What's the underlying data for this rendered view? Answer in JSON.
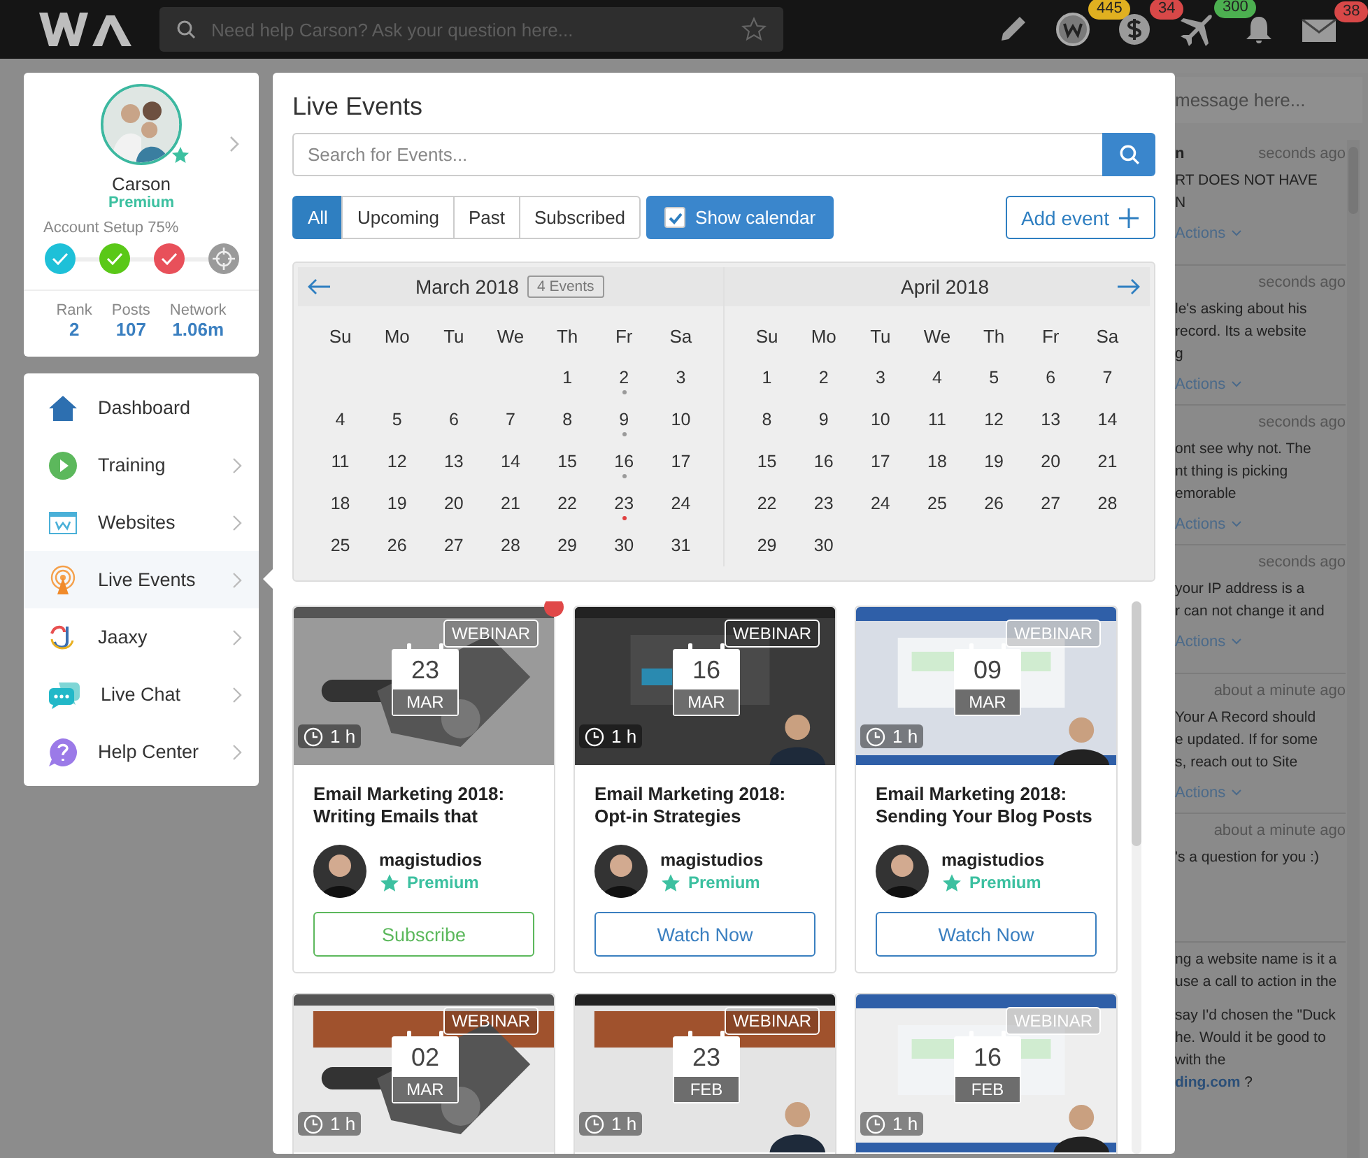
{
  "top_bar": {
    "search": {
      "placeholder": "Need help Carson? Ask your question here..."
    },
    "icons": [
      {
        "kind": "pencil"
      },
      {
        "kind": "coin",
        "count": "445",
        "color": "#e0b020"
      },
      {
        "kind": "dollar",
        "count": "34",
        "color": "#d84848"
      },
      {
        "kind": "plane",
        "count": "300",
        "color": "#4caf50"
      },
      {
        "kind": "bell"
      },
      {
        "kind": "mail",
        "count": "38",
        "color": "#d84848"
      }
    ]
  },
  "profile": {
    "name": "Carson",
    "tier": "Premium",
    "setup": "Account Setup 75%",
    "steps": [
      {
        "color": "#1ec0d8",
        "done": true
      },
      {
        "color": "#5ac818",
        "done": true
      },
      {
        "color": "#e8505a",
        "done": true
      },
      {
        "color": "#9a9a9a",
        "done": false
      }
    ],
    "stats": [
      {
        "label": "Rank",
        "value": "2"
      },
      {
        "label": "Posts",
        "value": "107"
      },
      {
        "label": "Network",
        "value": "1.06m"
      }
    ]
  },
  "sidebar": {
    "nav": [
      {
        "label": "Dashboard",
        "chevron": false,
        "selected": false
      },
      {
        "label": "Training",
        "chevron": true,
        "selected": false
      },
      {
        "label": "Websites",
        "chevron": true,
        "selected": false
      },
      {
        "label": "Live Events",
        "chevron": true,
        "selected": true
      },
      {
        "label": "Jaaxy",
        "chevron": true,
        "selected": false
      },
      {
        "label": "Live Chat",
        "chevron": true,
        "selected": false
      },
      {
        "label": "Help Center",
        "chevron": true,
        "selected": false
      }
    ]
  },
  "modal": {
    "title": "Live Events",
    "search": {
      "placeholder": "Search for Events..."
    },
    "tabs": [
      {
        "label": "All",
        "selected": true
      },
      {
        "label": "Upcoming",
        "selected": false
      },
      {
        "label": "Past",
        "selected": false
      },
      {
        "label": "Subscribed",
        "selected": false
      }
    ],
    "show_calendar": {
      "label": "Show calendar",
      "checked": true
    },
    "add_event": "Add event",
    "calendar": {
      "months": [
        {
          "title": "March 2018",
          "events_badge": "4 Events",
          "weekdays": [
            "Su",
            "Mo",
            "Tu",
            "We",
            "Th",
            "Fr",
            "Sa"
          ],
          "weeks": [
            [
              "1",
              {
                "label": "2",
                "color": "#9a9a9a"
              },
              "3"
            ],
            [
              "4",
              "5",
              "6",
              "7",
              "8",
              {
                "label": "9",
                "color": "#9a9a9a"
              },
              "10"
            ],
            [
              "11",
              "12",
              "13",
              "14",
              "15",
              {
                "label": "16",
                "color": "#9a9a9a"
              },
              "17"
            ],
            [
              "18",
              "19",
              "20",
              "21",
              "22",
              {
                "label": "23",
                "color": "#e04040"
              },
              "24"
            ],
            [
              "25",
              "26",
              "27",
              "28",
              "29",
              "30",
              "31"
            ]
          ]
        },
        {
          "title": "April 2018",
          "weekdays": [
            "Su",
            "Mo",
            "Tu",
            "We",
            "Th",
            "Fr",
            "Sa"
          ],
          "weeks": [
            [
              "1",
              "2",
              "3",
              "4",
              "5",
              "6",
              "7"
            ],
            [
              "8",
              "9",
              "10",
              "11",
              "12",
              "13",
              "14"
            ],
            [
              "15",
              "16",
              "17",
              "18",
              "19",
              "20",
              "21"
            ],
            [
              "22",
              "23",
              "24",
              "25",
              "26",
              "27",
              "28"
            ],
            [
              "29",
              "30"
            ]
          ]
        }
      ]
    },
    "events": [
      {
        "badge": "WEBINAR",
        "day": "23",
        "month": "MAR",
        "duration": "1 h",
        "unread": true,
        "title": "Email Marketing 2018: Writing Emails that",
        "author": "magistudios",
        "tier": "Premium",
        "button": {
          "kind": "subscribe",
          "label": "Subscribe"
        }
      },
      {
        "badge": "WEBINAR",
        "day": "16",
        "month": "MAR",
        "duration": "1 h",
        "unread": false,
        "title": "Email Marketing 2018: Opt-in Strategies",
        "author": "magistudios",
        "tier": "Premium",
        "button": {
          "kind": "watch",
          "label": "Watch Now"
        }
      },
      {
        "badge": "WEBINAR",
        "day": "09",
        "month": "MAR",
        "duration": "1 h",
        "unread": false,
        "title": "Email Marketing 2018: Sending Your Blog Posts",
        "author": "magistudios",
        "tier": "Premium",
        "button": {
          "kind": "watch",
          "label": "Watch Now"
        }
      },
      {
        "badge": "WEBINAR",
        "day": "02",
        "month": "MAR",
        "duration": "1 h",
        "unread": false
      },
      {
        "badge": "WEBINAR",
        "day": "23",
        "month": "FEB",
        "duration": "1 h",
        "unread": false
      },
      {
        "badge": "WEBINAR",
        "day": "16",
        "month": "FEB",
        "duration": "1 h",
        "unread": false
      }
    ]
  },
  "chat": {
    "input": {
      "placeholder": "message here..."
    },
    "messages": [
      {
        "name": "n",
        "time": "seconds ago",
        "lines": [
          "RT DOES NOT HAVE",
          "N"
        ],
        "actions": "Actions"
      },
      {
        "time": "seconds ago",
        "lines": [
          "le's asking about his",
          "record. Its a website",
          "g"
        ],
        "actions": "Actions"
      },
      {
        "time": "seconds ago",
        "lines": [
          "ont see why not. The",
          "nt thing is picking",
          "emorable"
        ],
        "actions": "Actions"
      },
      {
        "time": "seconds ago",
        "lines": [
          "your IP address is a",
          "r can not change it and"
        ],
        "actions": "Actions"
      },
      {
        "time": "about a minute ago",
        "lines": [
          "Your A Record should",
          "e updated. If for some",
          "s, reach out to Site"
        ],
        "actions": "Actions"
      },
      {
        "time": "about a minute ago",
        "lines": [
          "'s a question for you :)"
        ]
      },
      {
        "lines": [
          "ng a website name is it a",
          "use a call to action in the"
        ]
      },
      {
        "lines": [
          "say I'd chosen the \"Duck",
          "he. Would it be good to",
          "with the"
        ],
        "link": "ding.com",
        "after": "?"
      }
    ]
  }
}
